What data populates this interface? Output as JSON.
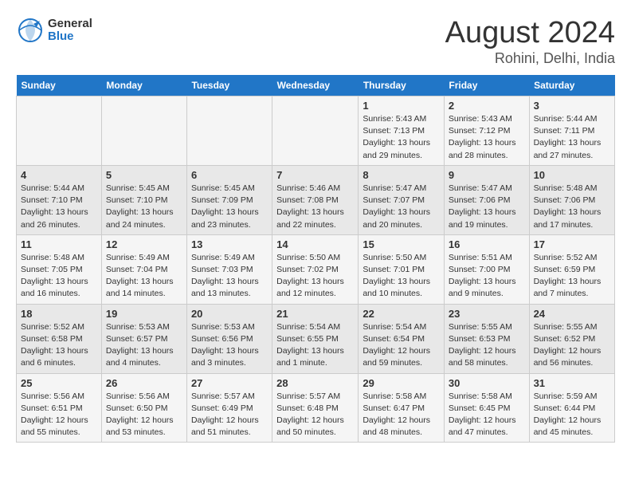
{
  "header": {
    "logo_general": "General",
    "logo_blue": "Blue",
    "title": "August 2024",
    "subtitle": "Rohini, Delhi, India"
  },
  "columns": [
    "Sunday",
    "Monday",
    "Tuesday",
    "Wednesday",
    "Thursday",
    "Friday",
    "Saturday"
  ],
  "weeks": [
    [
      {
        "day": "",
        "info": ""
      },
      {
        "day": "",
        "info": ""
      },
      {
        "day": "",
        "info": ""
      },
      {
        "day": "",
        "info": ""
      },
      {
        "day": "1",
        "info": "Sunrise: 5:43 AM\nSunset: 7:13 PM\nDaylight: 13 hours\nand 29 minutes."
      },
      {
        "day": "2",
        "info": "Sunrise: 5:43 AM\nSunset: 7:12 PM\nDaylight: 13 hours\nand 28 minutes."
      },
      {
        "day": "3",
        "info": "Sunrise: 5:44 AM\nSunset: 7:11 PM\nDaylight: 13 hours\nand 27 minutes."
      }
    ],
    [
      {
        "day": "4",
        "info": "Sunrise: 5:44 AM\nSunset: 7:10 PM\nDaylight: 13 hours\nand 26 minutes."
      },
      {
        "day": "5",
        "info": "Sunrise: 5:45 AM\nSunset: 7:10 PM\nDaylight: 13 hours\nand 24 minutes."
      },
      {
        "day": "6",
        "info": "Sunrise: 5:45 AM\nSunset: 7:09 PM\nDaylight: 13 hours\nand 23 minutes."
      },
      {
        "day": "7",
        "info": "Sunrise: 5:46 AM\nSunset: 7:08 PM\nDaylight: 13 hours\nand 22 minutes."
      },
      {
        "day": "8",
        "info": "Sunrise: 5:47 AM\nSunset: 7:07 PM\nDaylight: 13 hours\nand 20 minutes."
      },
      {
        "day": "9",
        "info": "Sunrise: 5:47 AM\nSunset: 7:06 PM\nDaylight: 13 hours\nand 19 minutes."
      },
      {
        "day": "10",
        "info": "Sunrise: 5:48 AM\nSunset: 7:06 PM\nDaylight: 13 hours\nand 17 minutes."
      }
    ],
    [
      {
        "day": "11",
        "info": "Sunrise: 5:48 AM\nSunset: 7:05 PM\nDaylight: 13 hours\nand 16 minutes."
      },
      {
        "day": "12",
        "info": "Sunrise: 5:49 AM\nSunset: 7:04 PM\nDaylight: 13 hours\nand 14 minutes."
      },
      {
        "day": "13",
        "info": "Sunrise: 5:49 AM\nSunset: 7:03 PM\nDaylight: 13 hours\nand 13 minutes."
      },
      {
        "day": "14",
        "info": "Sunrise: 5:50 AM\nSunset: 7:02 PM\nDaylight: 13 hours\nand 12 minutes."
      },
      {
        "day": "15",
        "info": "Sunrise: 5:50 AM\nSunset: 7:01 PM\nDaylight: 13 hours\nand 10 minutes."
      },
      {
        "day": "16",
        "info": "Sunrise: 5:51 AM\nSunset: 7:00 PM\nDaylight: 13 hours\nand 9 minutes."
      },
      {
        "day": "17",
        "info": "Sunrise: 5:52 AM\nSunset: 6:59 PM\nDaylight: 13 hours\nand 7 minutes."
      }
    ],
    [
      {
        "day": "18",
        "info": "Sunrise: 5:52 AM\nSunset: 6:58 PM\nDaylight: 13 hours\nand 6 minutes."
      },
      {
        "day": "19",
        "info": "Sunrise: 5:53 AM\nSunset: 6:57 PM\nDaylight: 13 hours\nand 4 minutes."
      },
      {
        "day": "20",
        "info": "Sunrise: 5:53 AM\nSunset: 6:56 PM\nDaylight: 13 hours\nand 3 minutes."
      },
      {
        "day": "21",
        "info": "Sunrise: 5:54 AM\nSunset: 6:55 PM\nDaylight: 13 hours\nand 1 minute."
      },
      {
        "day": "22",
        "info": "Sunrise: 5:54 AM\nSunset: 6:54 PM\nDaylight: 12 hours\nand 59 minutes."
      },
      {
        "day": "23",
        "info": "Sunrise: 5:55 AM\nSunset: 6:53 PM\nDaylight: 12 hours\nand 58 minutes."
      },
      {
        "day": "24",
        "info": "Sunrise: 5:55 AM\nSunset: 6:52 PM\nDaylight: 12 hours\nand 56 minutes."
      }
    ],
    [
      {
        "day": "25",
        "info": "Sunrise: 5:56 AM\nSunset: 6:51 PM\nDaylight: 12 hours\nand 55 minutes."
      },
      {
        "day": "26",
        "info": "Sunrise: 5:56 AM\nSunset: 6:50 PM\nDaylight: 12 hours\nand 53 minutes."
      },
      {
        "day": "27",
        "info": "Sunrise: 5:57 AM\nSunset: 6:49 PM\nDaylight: 12 hours\nand 51 minutes."
      },
      {
        "day": "28",
        "info": "Sunrise: 5:57 AM\nSunset: 6:48 PM\nDaylight: 12 hours\nand 50 minutes."
      },
      {
        "day": "29",
        "info": "Sunrise: 5:58 AM\nSunset: 6:47 PM\nDaylight: 12 hours\nand 48 minutes."
      },
      {
        "day": "30",
        "info": "Sunrise: 5:58 AM\nSunset: 6:45 PM\nDaylight: 12 hours\nand 47 minutes."
      },
      {
        "day": "31",
        "info": "Sunrise: 5:59 AM\nSunset: 6:44 PM\nDaylight: 12 hours\nand 45 minutes."
      }
    ]
  ]
}
